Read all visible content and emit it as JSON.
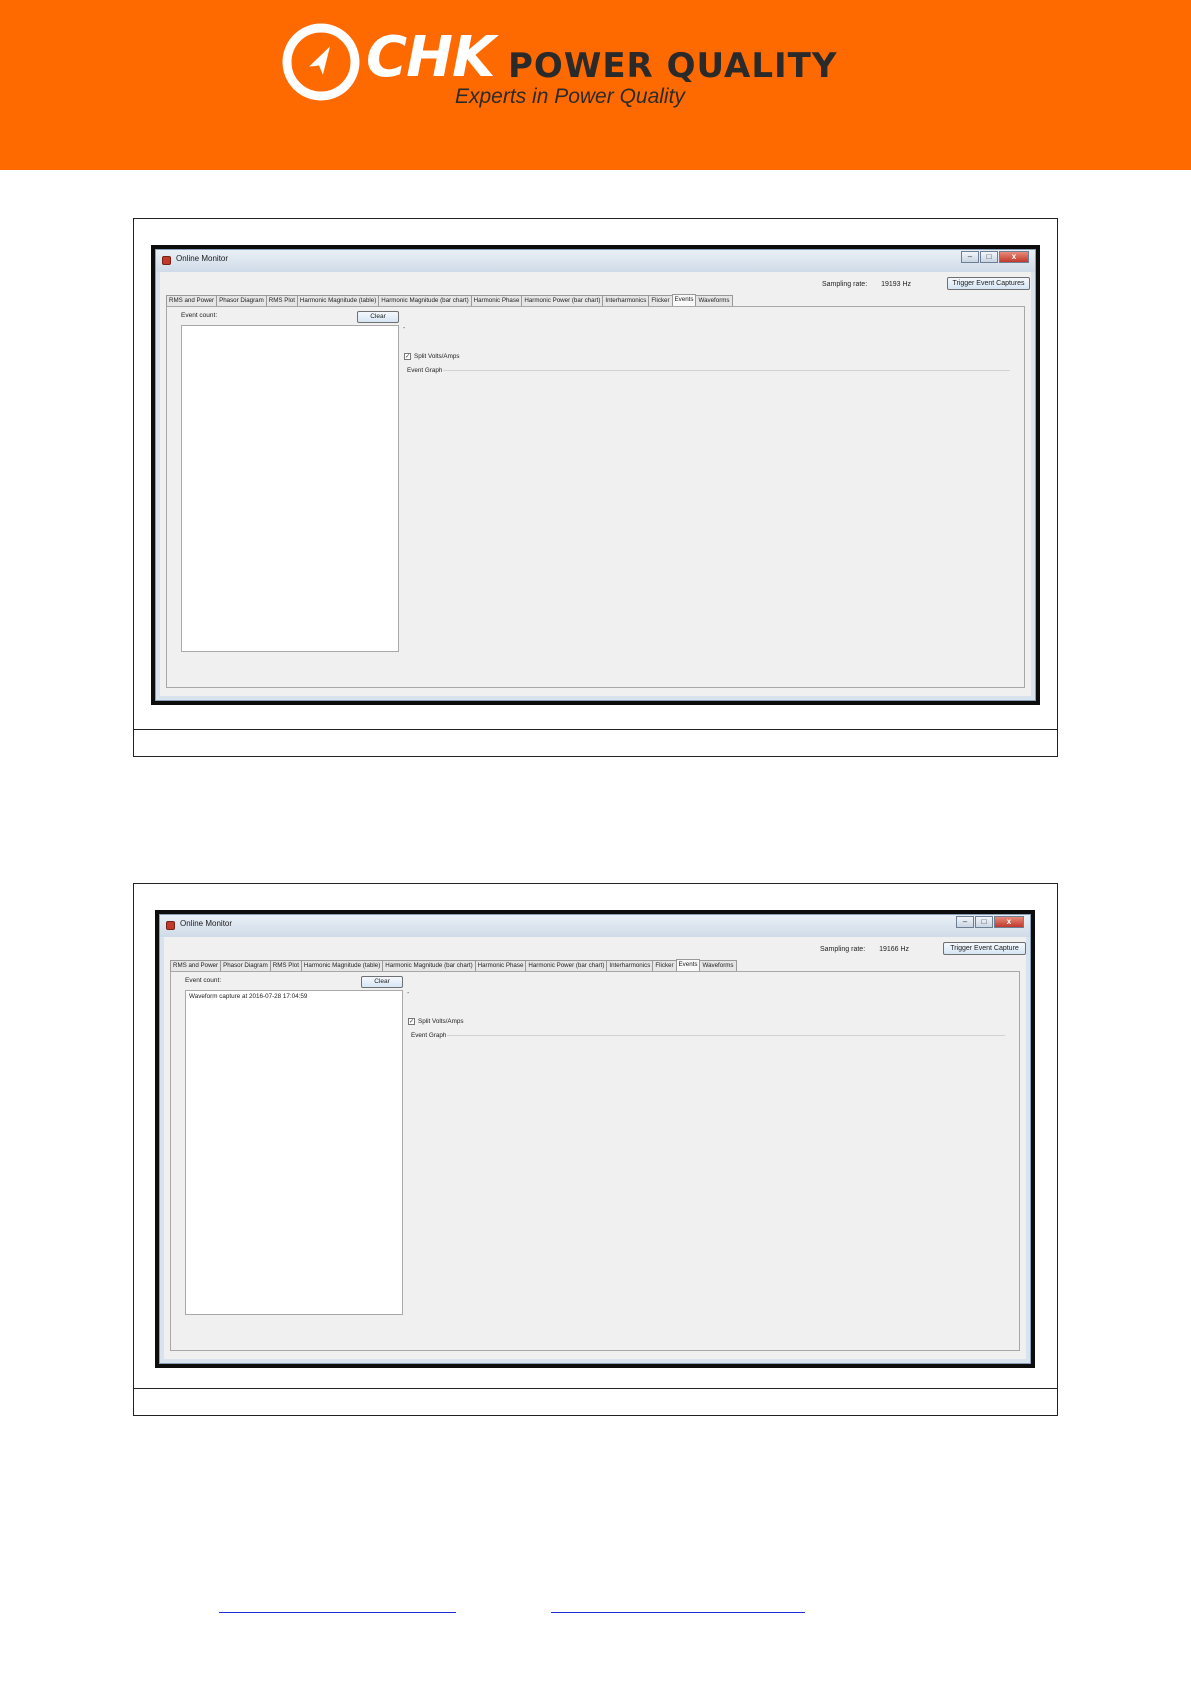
{
  "header": {
    "logo_word": "CHK",
    "logo_sub": "POWER QUALITY",
    "tagline": "Experts in Power Quality",
    "brand_color": "#ff6a00"
  },
  "screens": [
    {
      "window_title": "Online Monitor",
      "sampling_label": "Sampling rate:",
      "sampling_value": "19193 Hz",
      "trigger_label": "Trigger Event Captures",
      "tabs": [
        "RMS and Power",
        "Phasor Diagram",
        "RMS Plot",
        "Harmonic Magnitude (table)",
        "Harmonic Magnitude (bar chart)",
        "Harmonic Phase",
        "Harmonic Power (bar chart)",
        "Interharmonics",
        "Flicker",
        "Events",
        "Waveforms"
      ],
      "active_tab": "Events",
      "event_count_label": "Event count:",
      "clear_label": "Clear",
      "events": [],
      "dash": "-",
      "split_label": "Split Volts/Amps",
      "split_checked": true,
      "graph_label": "Event Graph"
    },
    {
      "window_title": "Online Monitor",
      "sampling_label": "Sampling rate:",
      "sampling_value": "19166 Hz",
      "trigger_label": "Trigger Event Capture",
      "tabs": [
        "RMS and Power",
        "Phasor Diagram",
        "RMS Plot",
        "Harmonic Magnitude (table)",
        "Harmonic Magnitude (bar chart)",
        "Harmonic Phase",
        "Harmonic Power (bar chart)",
        "Interharmonics",
        "Flicker",
        "Events",
        "Waveforms"
      ],
      "active_tab": "Events",
      "event_count_label": "Event count:",
      "clear_label": "Clear",
      "events": [
        "Waveform capture at 2016-07-28 17:04:59"
      ],
      "dash": "-",
      "split_label": "Split Volts/Amps",
      "split_checked": true,
      "graph_label": "Event Graph"
    }
  ]
}
